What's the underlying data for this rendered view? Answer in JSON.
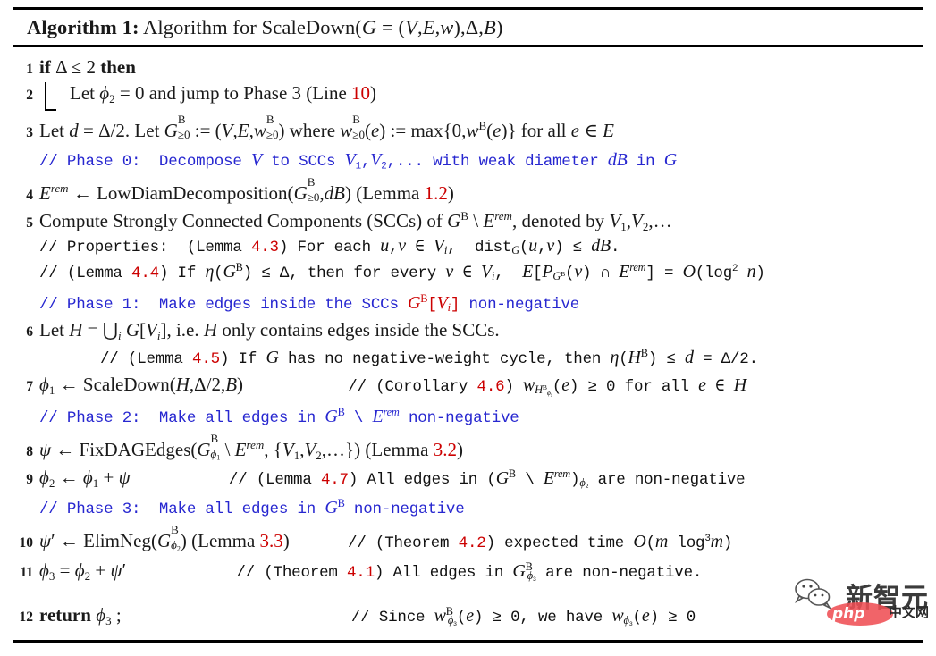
{
  "document": {
    "type": "algorithm-pseudocode",
    "caption_label": "Algorithm 1:",
    "caption_text": "Algorithm for ScaleDown(G = (V, E, w), Δ, B)",
    "colors": {
      "comment_blue": "#2727d0",
      "reference_red": "#cc0000",
      "text_black": "#1a1a1a"
    }
  },
  "lines": [
    {
      "number": "1",
      "kind": "code",
      "text": "if Δ ≤ 2 then"
    },
    {
      "number": "2",
      "kind": "code",
      "indent": 1,
      "text": "Let ϕ₂ = 0 and jump to Phase 3 (Line 10)",
      "ref": "10"
    },
    {
      "number": "3",
      "kind": "code",
      "text": "Let d = Δ/2. Let Gᴮ≥₀ := (V, E, wᴮ≥₀) where wᴮ≥₀(e) := max{0, wᴮ(e)} for all e ∈ E"
    },
    {
      "number": "",
      "kind": "comment",
      "text": "// Phase 0:  Decompose V to SCCs V₁, V₂, ... with weak diameter dB in G"
    },
    {
      "number": "4",
      "kind": "code",
      "text": "Eʳᵉᵐ ← LowDiamDecomposition(Gᴮ≥₀, dB) (Lemma 1.2)",
      "ref": "1.2"
    },
    {
      "number": "5",
      "kind": "code",
      "text": "Compute Strongly Connected Components (SCCs) of Gᴮ \\ Eʳᵉᵐ, denoted by V₁, V₂, ..."
    },
    {
      "number": "",
      "kind": "comment-black",
      "text": "// Properties:  (Lemma 4.3) For each u, v ∈ Vᵢ, dist_G(u, v) ≤ dB.",
      "ref": "4.3"
    },
    {
      "number": "",
      "kind": "comment-black",
      "text": "// (Lemma 4.4) If η(Gᴮ) ≤ Δ, then for every v ∈ Vᵢ, E[P_{Gᴮ}(v) ∩ Eʳᵉᵐ] = O(log² n)",
      "ref": "4.4"
    },
    {
      "number": "",
      "kind": "comment",
      "text": "// Phase 1:  Make edges inside the SCCs Gᴮ[Vᵢ] non-negative"
    },
    {
      "number": "6",
      "kind": "code",
      "text": "Let H = ⋃ᵢ G[Vᵢ], i.e. H only contains edges inside the SCCs."
    },
    {
      "number": "",
      "kind": "comment-black",
      "text": "// (Lemma 4.5) If G has no negative-weight cycle, then η(Hᴮ) ≤ d = Δ/2.",
      "ref": "4.5"
    },
    {
      "number": "7",
      "kind": "code",
      "text": "ϕ₁ ← ScaleDown(H, Δ/2, B)",
      "comment": "// (Corollary 4.6) w_{Hᴮ_{ϕ₁}}(e) ≥ 0 for all e ∈ H",
      "ref": "4.6"
    },
    {
      "number": "",
      "kind": "comment",
      "text": "// Phase 2:  Make all edges in Gᴮ \\ Eʳᵉᵐ non-negative"
    },
    {
      "number": "8",
      "kind": "code",
      "text": "ψ ← FixDAGEdges(Gᴮ_{ϕ₁} \\ Eʳᵉᵐ, {V₁, V₂, ...}) (Lemma 3.2)",
      "ref": "3.2"
    },
    {
      "number": "9",
      "kind": "code",
      "text": "ϕ₂ ← ϕ₁ + ψ",
      "comment": "// (Lemma 4.7) All edges in (Gᴮ \\ Eʳᵉᵐ)_{ϕ₂} are non-negative",
      "ref": "4.7"
    },
    {
      "number": "",
      "kind": "comment",
      "text": "// Phase 3:  Make all edges in Gᴮ non-negative"
    },
    {
      "number": "10",
      "kind": "code",
      "text": "ψ' ← ElimNeg(Gᴮ_{ϕ₂}) (Lemma 3.3)",
      "comment": "// (Theorem 4.2) expected time O(m log³ m)",
      "ref": "3.3",
      "ref2": "4.2"
    },
    {
      "number": "11",
      "kind": "code",
      "text": "ϕ₃ = ϕ₂ + ψ'",
      "comment": "// (Theorem 4.1) All edges in Gᴮ_{ϕ₃} are non-negative.",
      "ref": "4.1"
    },
    {
      "number": "12",
      "kind": "code",
      "text": "return ϕ₃ ;",
      "comment": "// Since wᴮ_{ϕ₃}(e) ≥ 0, we have w_{ϕ₃}(e) ≥ 0"
    }
  ],
  "refs": {
    "line10": "10",
    "lemma12": "1.2",
    "lemma43": "4.3",
    "lemma44": "4.4",
    "lemma45": "4.5",
    "corollary46": "4.6",
    "lemma32": "3.2",
    "lemma47": "4.7",
    "lemma33": "3.3",
    "theorem42": "4.2",
    "theorem41": "4.1"
  },
  "watermark": {
    "brand_cn": "新智元",
    "badge_text": "php",
    "suffix_cn": "中文网"
  }
}
